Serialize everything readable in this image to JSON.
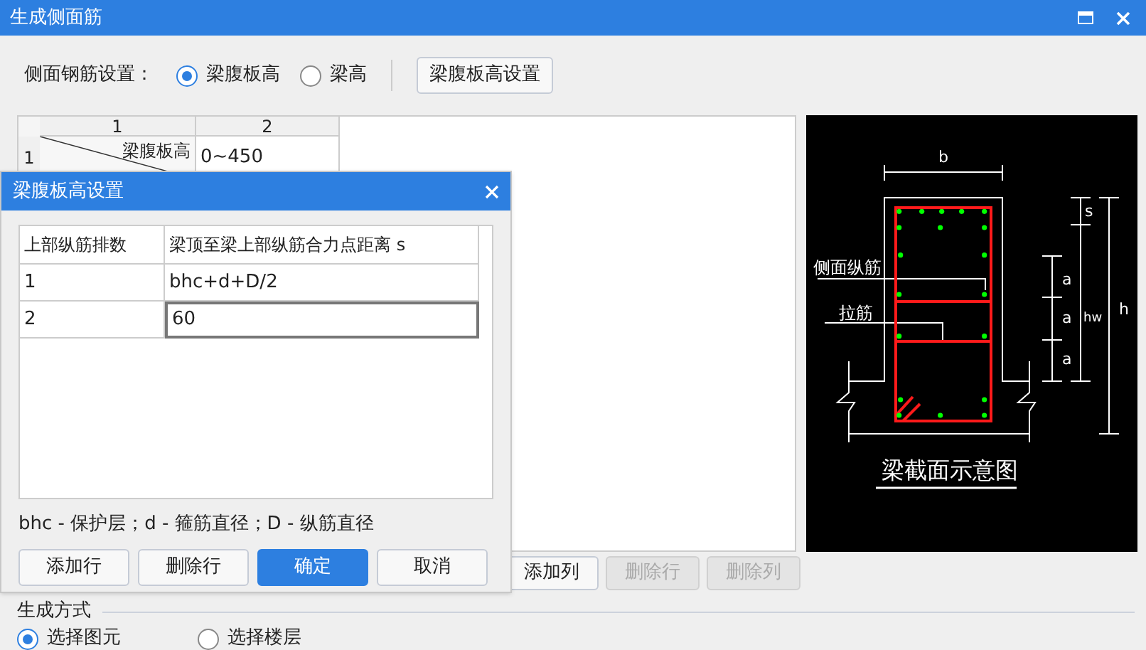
{
  "window": {
    "title": "生成侧面筋"
  },
  "side_rebar_setting": {
    "label": "侧面钢筋设置：",
    "options": [
      {
        "label": "梁腹板高",
        "selected": true
      },
      {
        "label": "梁高",
        "selected": false
      }
    ],
    "button": "梁腹板高设置"
  },
  "grid": {
    "column_headers": [
      "1",
      "2"
    ],
    "rows": [
      {
        "header": "1",
        "diagonal_top": "梁腹板高",
        "value": "0~450"
      }
    ]
  },
  "grid_buttons": [
    {
      "label": "添加列",
      "disabled": false
    },
    {
      "label": "删除行",
      "disabled": true
    },
    {
      "label": "删除列",
      "disabled": true
    }
  ],
  "diagram": {
    "title": "梁截面示意图",
    "dimension_labels": [
      "b",
      "s",
      "a",
      "a",
      "a",
      "hw",
      "h"
    ],
    "callouts": [
      "侧面纵筋",
      "拉筋"
    ]
  },
  "generation": {
    "title": "生成方式",
    "options": [
      {
        "label": "选择图元",
        "selected": true
      },
      {
        "label": "选择楼层",
        "selected": false
      }
    ]
  },
  "dialog": {
    "title": "梁腹板高设置",
    "columns": [
      "上部纵筋排数",
      "梁顶至梁上部纵筋合力点距离 s"
    ],
    "rows": [
      {
        "cells": [
          "1",
          "bhc+d+D/2"
        ],
        "selected": false
      },
      {
        "cells": [
          "2",
          "60"
        ],
        "selected": true
      }
    ],
    "note": "bhc - 保护层；d - 箍筋直径；D - 纵筋直径",
    "buttons": [
      {
        "label": "添加行",
        "primary": false
      },
      {
        "label": "删除行",
        "primary": false
      },
      {
        "label": "确定",
        "primary": true
      },
      {
        "label": "取消",
        "primary": false
      }
    ]
  }
}
